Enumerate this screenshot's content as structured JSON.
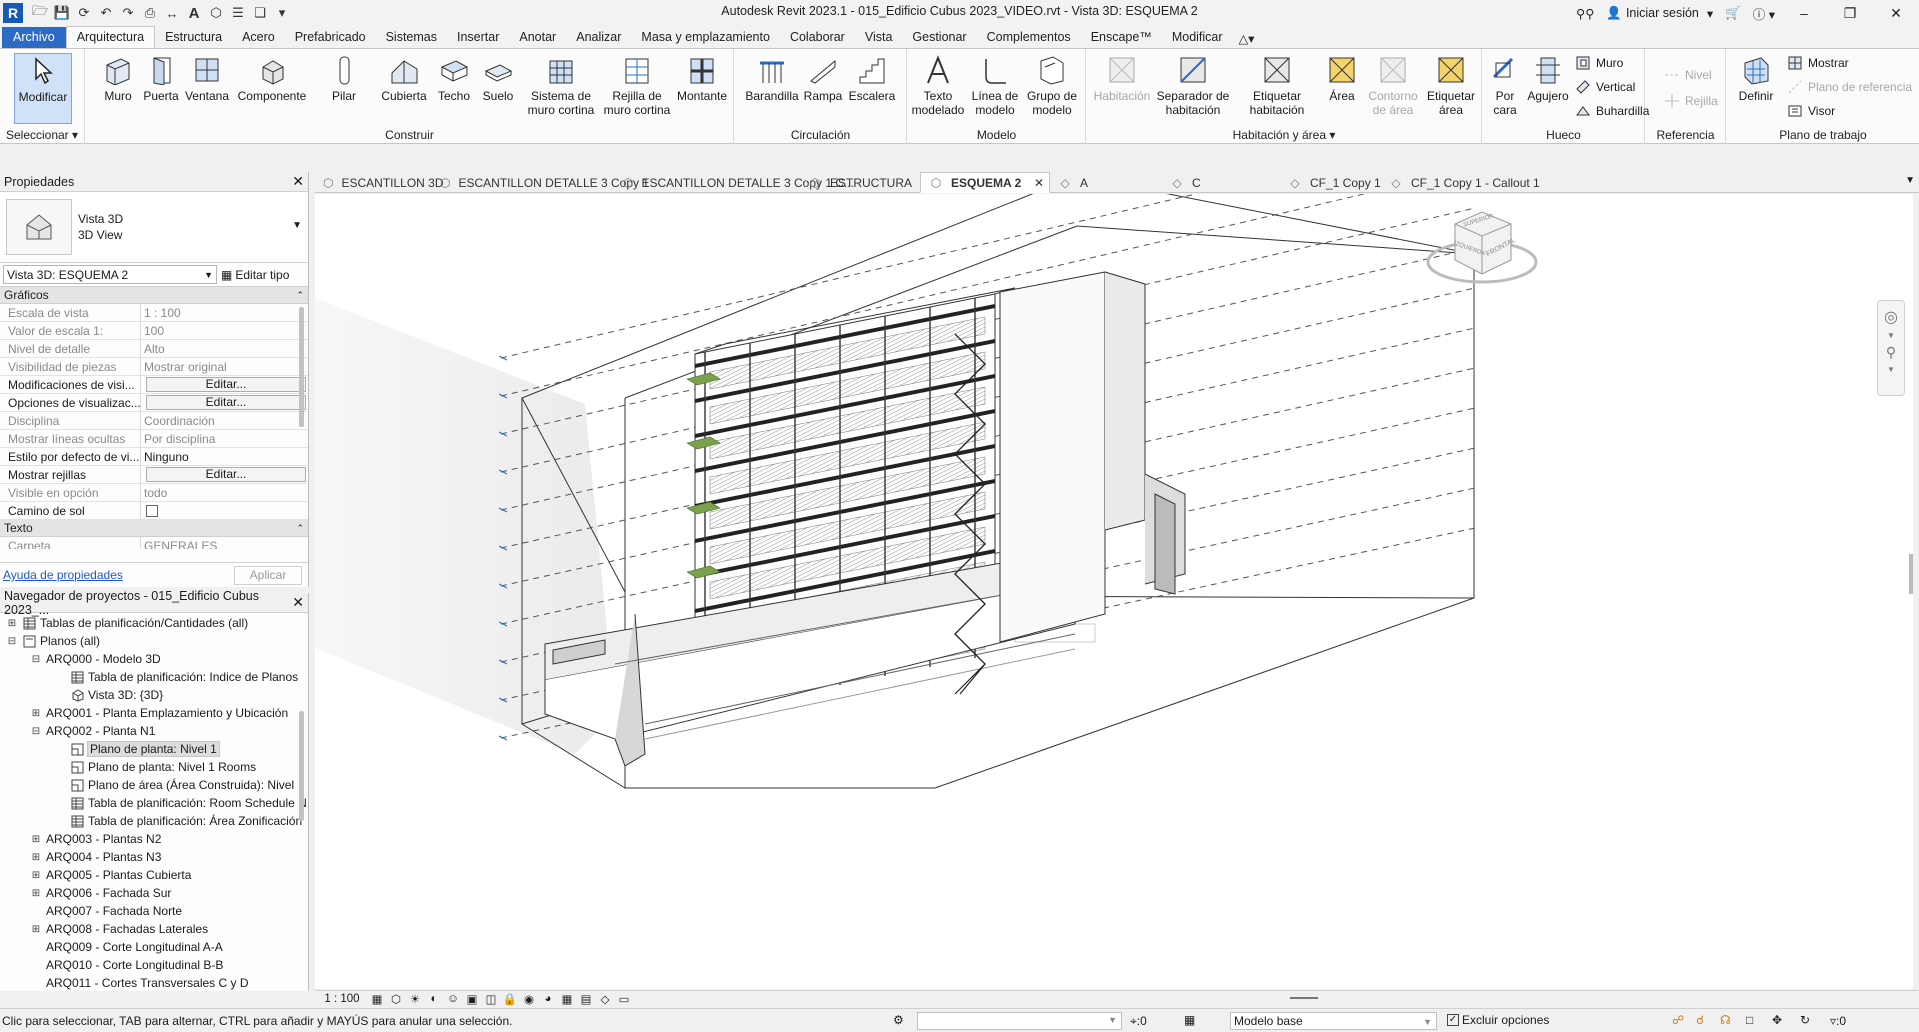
{
  "app": {
    "logo": "R",
    "title": "Autodesk Revit 2023.1 - 015_Edificio Cubus 2023_VIDEO.rvt - Vista 3D: ESQUEMA 2",
    "signin": "Iniciar sesión",
    "accent": "#2b6bc6"
  },
  "ribbon_tabs": [
    "Archivo",
    "Arquitectura",
    "Estructura",
    "Acero",
    "Prefabricado",
    "Sistemas",
    "Insertar",
    "Anotar",
    "Analizar",
    "Masa y emplazamiento",
    "Colaborar",
    "Vista",
    "Gestionar",
    "Complementos",
    "Enscape™",
    "Modificar"
  ],
  "ribbon": {
    "seleccionar": {
      "label": "Seleccionar ▾",
      "modificar": "Modificar"
    },
    "construir": {
      "label": "Construir",
      "buttons": [
        "Muro",
        "Puerta",
        "Ventana",
        "Componente",
        "Pilar",
        "Cubierta",
        "Techo",
        "Suelo",
        "Sistema de muro cortina",
        "Rejilla de muro cortina",
        "Montante"
      ]
    },
    "circulacion": {
      "label": "Circulación",
      "buttons": [
        "Barandilla",
        "Rampa",
        "Escalera"
      ]
    },
    "modelo": {
      "label": "Modelo",
      "buttons": [
        "Texto modelado",
        "Línea de modelo",
        "Grupo de modelo"
      ]
    },
    "habitacion": {
      "label": "Habitación y área ▾",
      "buttons": [
        "Habitación",
        "Separador de habitación",
        "Etiquetar habitación",
        "Área",
        "Contorno de área",
        "Etiquetar área"
      ]
    },
    "hueco": {
      "label": "Hueco",
      "buttons": [
        "Por cara",
        "Agujero"
      ],
      "small": [
        "Muro",
        "Vertical",
        "Buhardilla"
      ]
    },
    "referencia": {
      "label": "Referencia",
      "small": [
        "Nivel",
        "Rejilla"
      ]
    },
    "plano": {
      "label": "Plano de trabajo",
      "definir": "Definir",
      "small": [
        "Mostrar",
        "Plano de referencia",
        "Visor"
      ]
    }
  },
  "properties": {
    "header": "Propiedades",
    "type_name": "Vista 3D",
    "type_sub": "3D View",
    "instance": "Vista 3D: ESQUEMA 2",
    "edit_type": "Editar tipo",
    "sections": {
      "graficos": "Gráficos",
      "texto": "Texto"
    },
    "rows": [
      {
        "k": "Escala de vista",
        "v": "1 : 100",
        "gray": true
      },
      {
        "k": "Valor de escala    1:",
        "v": "100",
        "gray": true
      },
      {
        "k": "Nivel de detalle",
        "v": "Alto",
        "gray": true
      },
      {
        "k": "Visibilidad de piezas",
        "v": "Mostrar original",
        "gray": true
      },
      {
        "k": "Modificaciones de visi...",
        "v": "Editar...",
        "btn": true
      },
      {
        "k": "Opciones de visualizac...",
        "v": "Editar...",
        "btn": true
      },
      {
        "k": "Disciplina",
        "v": "Coordinación",
        "gray": true
      },
      {
        "k": "Mostrar líneas ocultas",
        "v": "Por disciplina",
        "gray": true
      },
      {
        "k": "Estilo por defecto de vi...",
        "v": "Ninguno"
      },
      {
        "k": "Mostrar rejillas",
        "v": "Editar...",
        "btn": true
      },
      {
        "k": "Visible en opción",
        "v": "todo",
        "gray": true
      },
      {
        "k": "Camino de sol",
        "v": "",
        "checkbox": true
      }
    ],
    "text_rows": [
      {
        "k": "Carpeta",
        "v": "GENERALES",
        "gray": true
      }
    ],
    "help_link": "Ayuda de propiedades",
    "apply": "Aplicar"
  },
  "browser": {
    "header": "Navegador de proyectos - 015_Edificio Cubus 2023_...",
    "nodes": [
      {
        "indent": 0,
        "toggle": "+",
        "icon": "table",
        "label": "Tablas de planificación/Cantidades (all)"
      },
      {
        "indent": 0,
        "toggle": "−",
        "icon": "sheet",
        "label": "Planos (all)"
      },
      {
        "indent": 1,
        "toggle": "−",
        "icon": "",
        "label": "ARQ000 - Modelo 3D"
      },
      {
        "indent": 2,
        "toggle": "",
        "icon": "table",
        "label": "Tabla de planificación: Indice de Planos"
      },
      {
        "indent": 2,
        "toggle": "",
        "icon": "cube",
        "label": "Vista 3D: {3D}"
      },
      {
        "indent": 1,
        "toggle": "+",
        "icon": "",
        "label": "ARQ001 - Planta Emplazamiento y Ubicación"
      },
      {
        "indent": 1,
        "toggle": "−",
        "icon": "",
        "label": "ARQ002 - Planta N1"
      },
      {
        "indent": 2,
        "toggle": "",
        "icon": "plan",
        "label": "Plano de planta: Nivel 1",
        "sel": true
      },
      {
        "indent": 2,
        "toggle": "",
        "icon": "plan",
        "label": "Plano de planta: Nivel 1 Rooms"
      },
      {
        "indent": 2,
        "toggle": "",
        "icon": "plan",
        "label": "Plano de área (Área Construida): Nivel"
      },
      {
        "indent": 2,
        "toggle": "",
        "icon": "table",
        "label": "Tabla de planificación: Room Schedule N"
      },
      {
        "indent": 2,
        "toggle": "",
        "icon": "table",
        "label": "Tabla de planificación: Área Zonificación"
      },
      {
        "indent": 1,
        "toggle": "+",
        "icon": "",
        "label": "ARQ003 - Plantas N2"
      },
      {
        "indent": 1,
        "toggle": "+",
        "icon": "",
        "label": "ARQ004 - Plantas N3"
      },
      {
        "indent": 1,
        "toggle": "+",
        "icon": "",
        "label": "ARQ005 - Plantas Cubierta"
      },
      {
        "indent": 1,
        "toggle": "+",
        "icon": "",
        "label": "ARQ006 - Fachada Sur"
      },
      {
        "indent": 1,
        "toggle": "",
        "icon": "",
        "label": "ARQ007 - Fachada Norte"
      },
      {
        "indent": 1,
        "toggle": "+",
        "icon": "",
        "label": "ARQ008 - Fachadas Laterales"
      },
      {
        "indent": 1,
        "toggle": "",
        "icon": "",
        "label": "ARQ009 - Corte Longitudinal A-A"
      },
      {
        "indent": 1,
        "toggle": "",
        "icon": "",
        "label": "ARQ010 - Corte Longitudinal B-B"
      },
      {
        "indent": 1,
        "toggle": "",
        "icon": "",
        "label": "ARQ011 - Cortes Transversales C y D"
      }
    ]
  },
  "view_tabs": [
    {
      "label": "ESCANTILLON 3D",
      "icon": "cube-icon"
    },
    {
      "label": "ESCANTILLON DETALLE 3 Copy 1",
      "icon": "cube-icon"
    },
    {
      "label": "ESCANTILLON DETALLE 3 Copy 1 C...",
      "icon": "cube-icon"
    },
    {
      "label": "ESTRUCTURA",
      "icon": "cube-icon"
    },
    {
      "label": "ESQUEMA 2",
      "icon": "cube-icon",
      "active": true
    },
    {
      "label": "A",
      "icon": "section-icon"
    },
    {
      "label": "C",
      "icon": "section-icon"
    },
    {
      "label": "CF_1 Copy 1",
      "icon": "section-icon"
    },
    {
      "label": "CF_1 Copy 1 - Callout 1",
      "icon": "section-icon"
    }
  ],
  "viewcube": {
    "face_top": "SUPERIOR",
    "face_front": "FRONTAL",
    "face_left": "IZQUIERDA"
  },
  "view_bar": {
    "scale": "1 : 100"
  },
  "status": {
    "message": "Clic para seleccionar, TAB para alternar, CTRL para añadir y MAYÚS para anular una selección.",
    "selection_count": ":0",
    "model": "Modelo base",
    "exclude": "Excluir opciones",
    "filter_count": ":0"
  }
}
